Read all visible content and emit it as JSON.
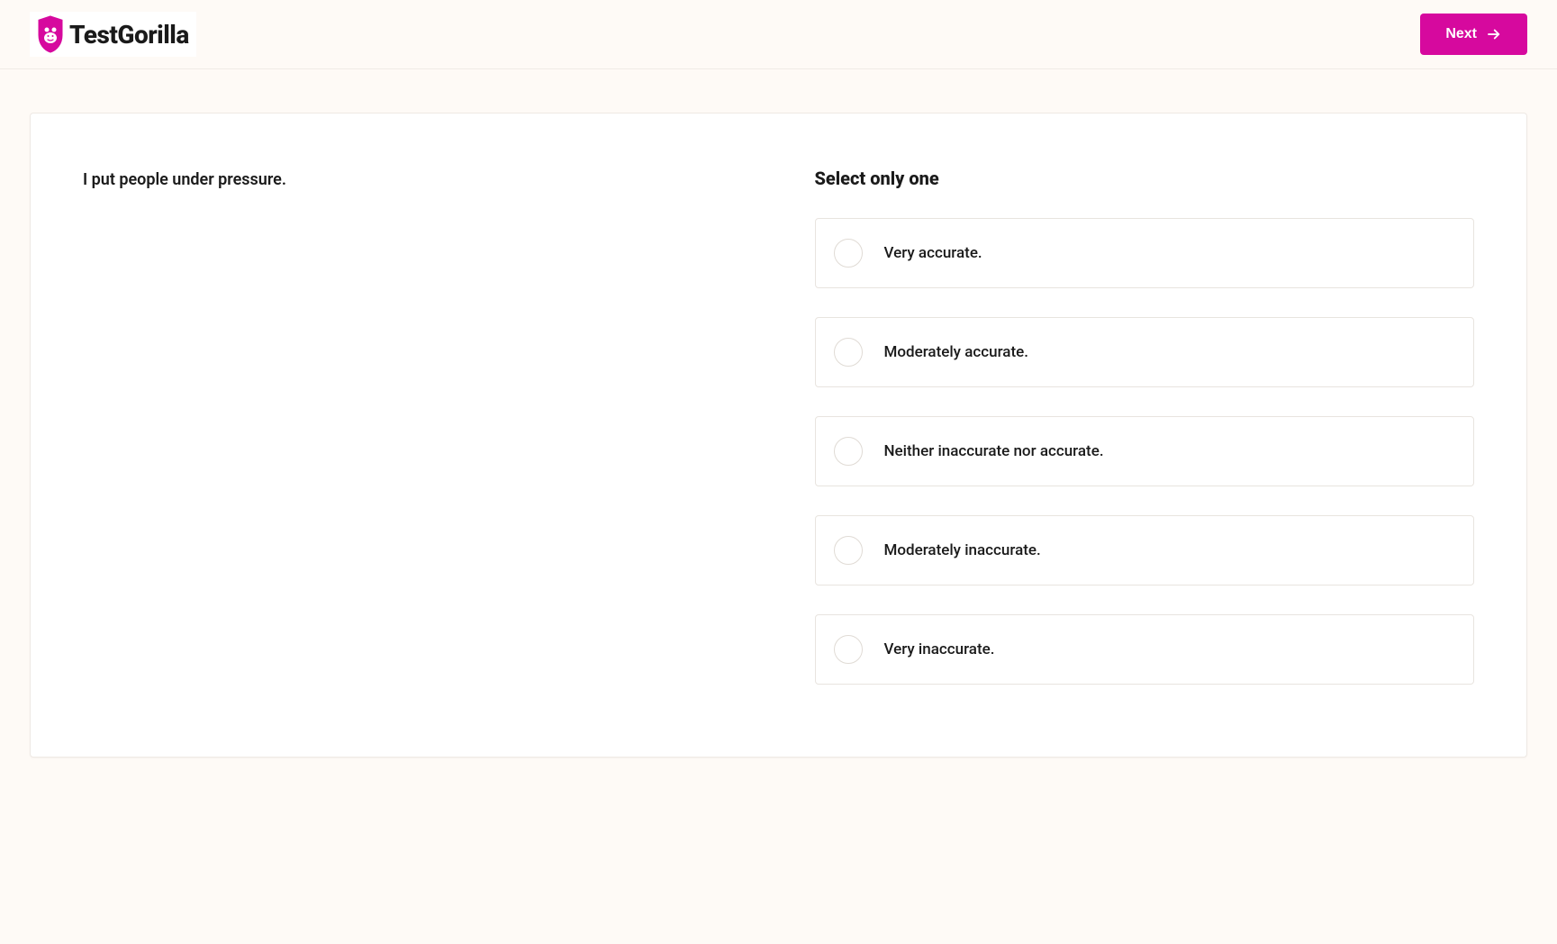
{
  "header": {
    "brand_name": "TestGorilla",
    "next_label": "Next"
  },
  "question": {
    "prompt": "I put people under pressure.",
    "instruction": "Select only one",
    "options": [
      "Very accurate.",
      "Moderately accurate.",
      "Neither inaccurate nor accurate.",
      "Moderately inaccurate.",
      "Very inaccurate."
    ]
  },
  "colors": {
    "accent": "#d6099e",
    "background": "#fefaf6",
    "card_bg": "#ffffff"
  }
}
